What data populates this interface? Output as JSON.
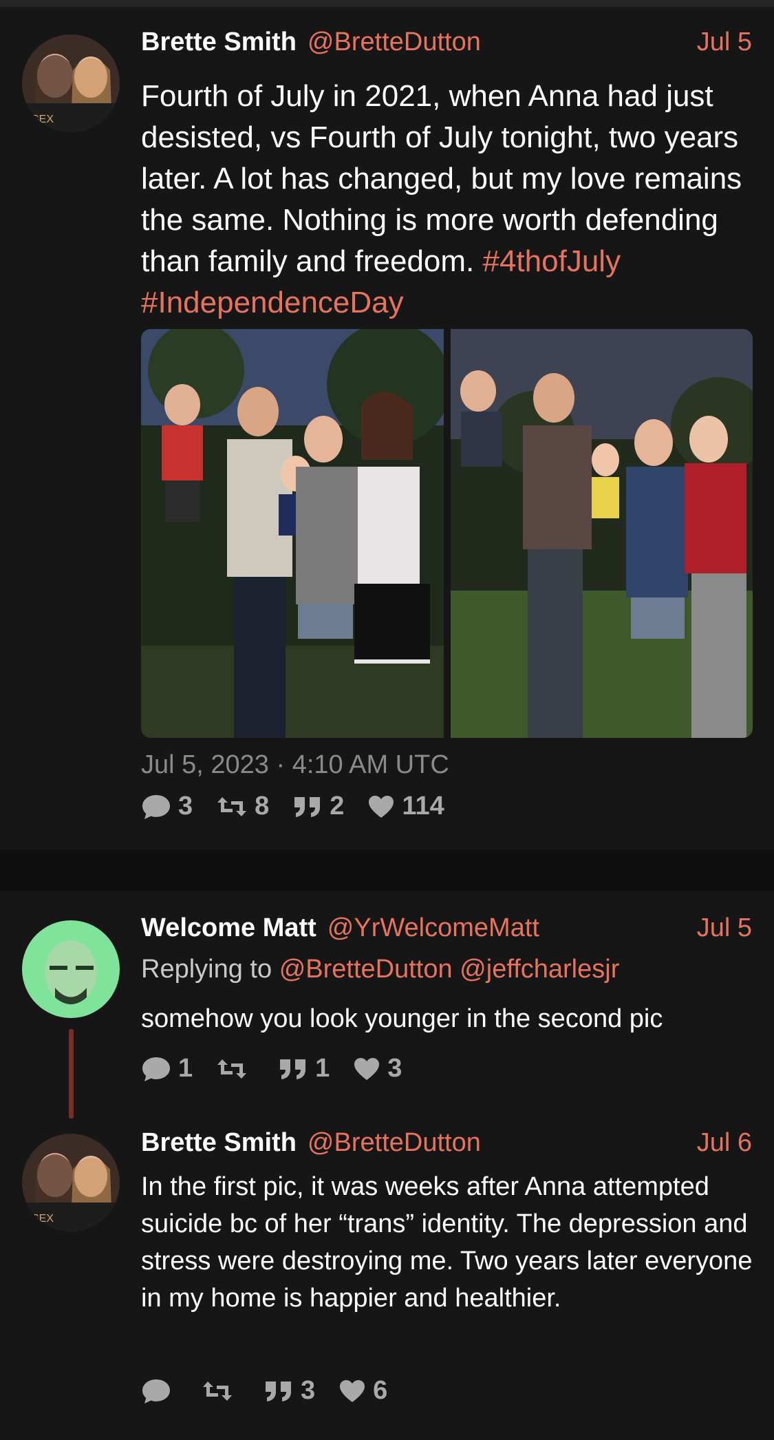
{
  "tweet1": {
    "display_name": "Brette Smith",
    "handle": "@BretteDutton",
    "date": "Jul 5",
    "text": "Fourth of July in 2021, when Anna had just desisted, vs Fourth of July tonight, two years later. A lot has changed, but my love remains the same. Nothing is more worth defending than family and freedom. ",
    "hashtags": [
      "#4thofJuly",
      "#IndependenceDay"
    ],
    "timestamp": "Jul 5, 2023 · 4:10 AM UTC",
    "stats": {
      "replies": "3",
      "retweets": "8",
      "quotes": "2",
      "likes": "114"
    }
  },
  "tweet2": {
    "display_name": "Welcome Matt",
    "handle": "@YrWelcomeMatt",
    "date": "Jul 5",
    "replying_prefix": "Replying to",
    "replying_to": [
      "@BretteDutton",
      "@jeffcharlesjr"
    ],
    "text": "somehow you look younger in the second pic",
    "stats": {
      "replies": "1",
      "retweets": "",
      "quotes": "1",
      "likes": "3"
    }
  },
  "tweet3": {
    "display_name": "Brette Smith",
    "handle": "@BretteDutton",
    "date": "Jul 6",
    "text": "In the first pic, it was weeks after Anna attempted suicide bc of her “trans” identity.  The depression and stress were destroying me. Two years later everyone in my home is happier and healthier.",
    "stats": {
      "replies": "",
      "retweets": "",
      "quotes": "3",
      "likes": "6"
    }
  },
  "icons": {
    "reply": "comment-bubble-icon",
    "retweet": "retweet-icon",
    "quote": "quote-icon",
    "like": "heart-icon"
  },
  "colors": {
    "accent": "#e8735c",
    "background": "#161616",
    "thread_line": "#7a2e26",
    "muted": "#8a8a8a"
  }
}
